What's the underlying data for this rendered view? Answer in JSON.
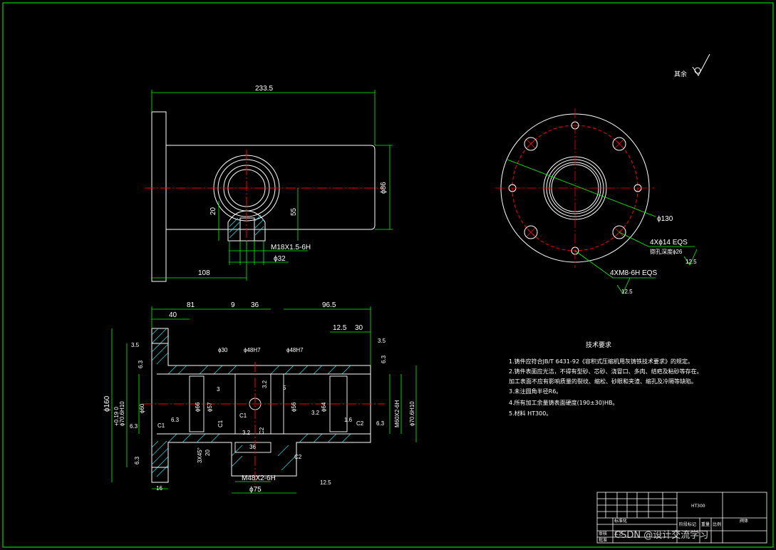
{
  "colors": {
    "background": "#000000",
    "outline": "#ffffff",
    "dimension": "#00ff00",
    "centerline": "#ff0000",
    "hatch": "#00ffff",
    "frame": "#00ff00"
  },
  "roughness_note": "其余",
  "top_view": {
    "overall_length": "233.5",
    "diameter": "ϕ86",
    "height_20": "20",
    "height_55": "55",
    "thread": "M18X1.5-6H",
    "boss_dia": "ϕ32",
    "offset": "108"
  },
  "end_view": {
    "bolt_circle": "ϕ130",
    "holes": "4Xϕ14  EQS",
    "counterbore": "锪孔深度ϕ26",
    "holes_roughness": "12.5",
    "tapped": "4XM8-6H  EQS",
    "tapped_roughness": "12.5"
  },
  "section_view": {
    "top_dims": [
      "40",
      "81",
      "9",
      "36",
      "96.5",
      "12.5",
      "30"
    ],
    "flange_dia": "ϕ160",
    "bore_dims": [
      "ϕ70.6H10",
      "ϕ60",
      "ϕ66",
      "ϕ57",
      "ϕ30",
      "ϕ48H7",
      "ϕ48H7",
      "ϕ56",
      "ϕ64",
      "ϕ70.6H10",
      "M60X2-6H"
    ],
    "tolerance": "+0.19\n0",
    "roughness": [
      "3.5",
      "6.3",
      "6.3",
      "6.3",
      "6.3",
      "6.3",
      "6.3",
      "3.5",
      "3.2",
      "3.2",
      "3.2",
      "1.6",
      "12.5"
    ],
    "chamfers": [
      "C1",
      "C1",
      "C1",
      "C2",
      "C2",
      "C2"
    ],
    "small_dims": [
      "3",
      "5",
      "36",
      "20",
      "3X45°",
      "16"
    ],
    "bottom_thread": "M48X2-6H",
    "bottom_dia": "ϕ75"
  },
  "tech_requirements": {
    "title": "技术要求",
    "items": [
      "1.铸件应符合JB/T 6431-92《容积式压缩机用灰铸铁技术要求》的规定。",
      "2.铸件表面应光洁，不得有型砂、芯砂、浇冒口、多肉、结疤及粘砂等存在。",
      "加工表面不应有影响质量的裂纹、缩松、砂眼和夹渣、缩孔及冷隔等缺陷。",
      "3.未注圆角半径R6。",
      "4.所有加工余量铸表面硬度(190±30)HB。",
      "5.材料 HT300。"
    ]
  },
  "title_block": {
    "material": "HT300",
    "part_name": "阀体",
    "cells": [
      "阶段标记",
      "重量",
      "比例",
      "标准化",
      "审核",
      "工艺",
      "批准"
    ]
  },
  "watermark": "CSDN @设计交流学习"
}
